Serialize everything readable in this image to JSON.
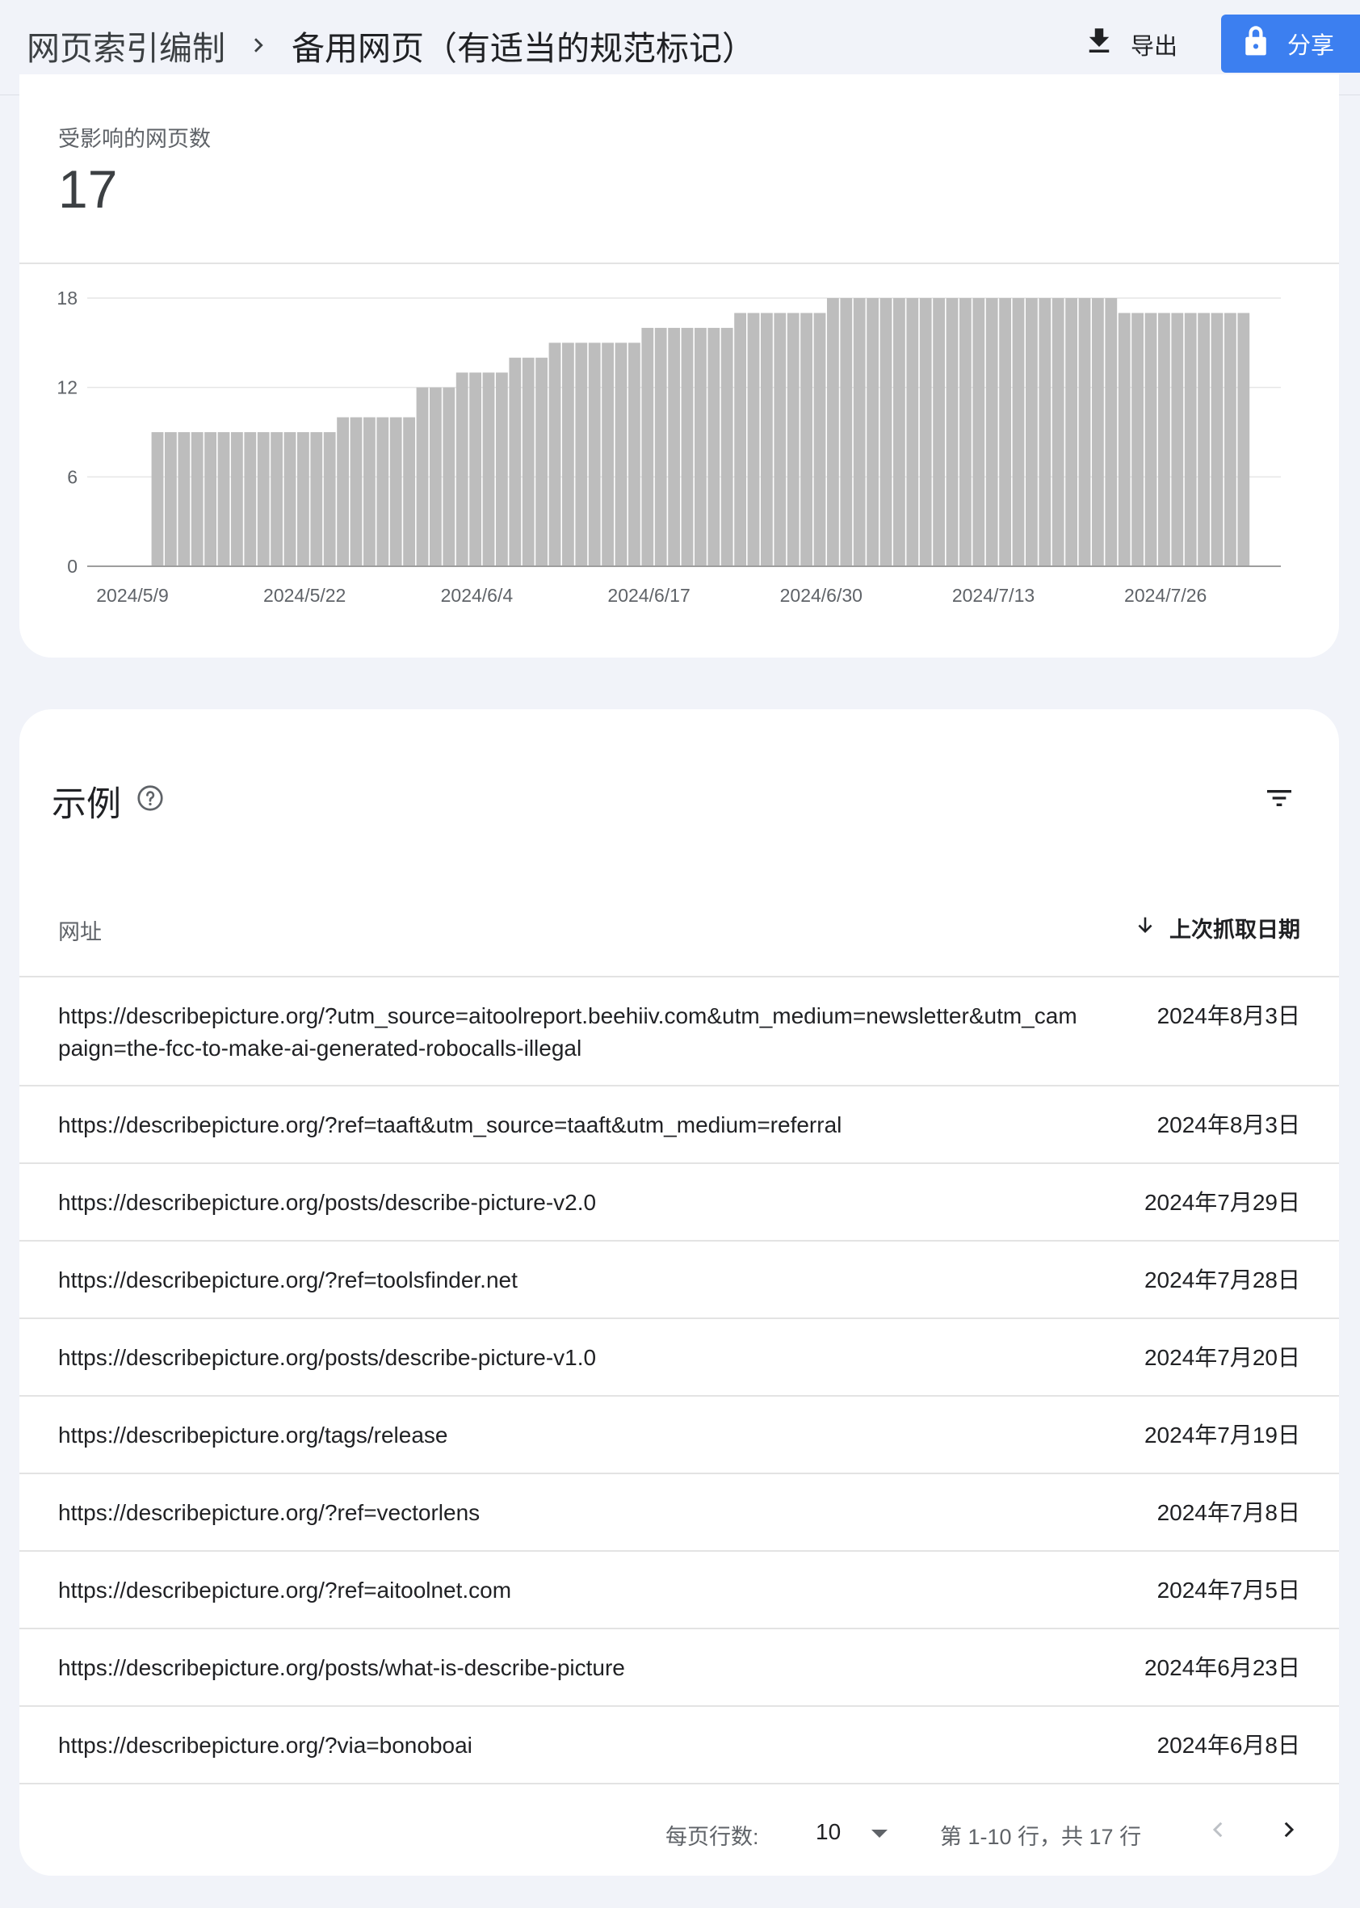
{
  "header": {
    "breadcrumb_parent": "网页索引编制",
    "breadcrumb_current": "备用网页（有适当的规范标记）",
    "export_label": "导出",
    "share_label": "分享"
  },
  "summary": {
    "metric_label": "受影响的网页数",
    "metric_value": "17"
  },
  "chart_data": {
    "type": "bar",
    "title": "",
    "xlabel": "",
    "ylabel": "",
    "ylim": [
      0,
      18
    ],
    "yticks": [
      0,
      6,
      12,
      18
    ],
    "xtick_labels": [
      "2024/5/9",
      "2024/5/22",
      "2024/6/4",
      "2024/6/17",
      "2024/6/30",
      "2024/7/13",
      "2024/7/26"
    ],
    "xtick_indices": [
      0,
      13,
      26,
      39,
      52,
      65,
      78
    ],
    "start_label": "2024/5/9",
    "grid": true,
    "bar_color": "#bdbdbd",
    "values": [
      0,
      0,
      0,
      0,
      9,
      9,
      9,
      9,
      9,
      9,
      9,
      9,
      9,
      9,
      9,
      9,
      9,
      9,
      10,
      10,
      10,
      10,
      10,
      10,
      12,
      12,
      12,
      13,
      13,
      13,
      13,
      14,
      14,
      14,
      15,
      15,
      15,
      15,
      15,
      15,
      15,
      16,
      16,
      16,
      16,
      16,
      16,
      16,
      17,
      17,
      17,
      17,
      17,
      17,
      17,
      18,
      18,
      18,
      18,
      18,
      18,
      18,
      18,
      18,
      18,
      18,
      18,
      18,
      18,
      18,
      18,
      18,
      18,
      18,
      18,
      18,
      18,
      17,
      17,
      17,
      17,
      17,
      17,
      17,
      17,
      17,
      17
    ]
  },
  "examples": {
    "title": "示例",
    "help_icon": "help-circle-icon",
    "filter_icon": "filter-icon",
    "columns": {
      "url": "网址",
      "date": "上次抓取日期"
    },
    "sort_icon": "arrow-down-icon",
    "rows": [
      {
        "url": "https://describepicture.org/?utm_source=aitoolreport.beehiiv.com&utm_medium=newsletter&utm_campaign=the-fcc-to-make-ai-generated-robocalls-illegal",
        "date": "2024年8月3日"
      },
      {
        "url": "https://describepicture.org/?ref=taaft&utm_source=taaft&utm_medium=referral",
        "date": "2024年8月3日"
      },
      {
        "url": "https://describepicture.org/posts/describe-picture-v2.0",
        "date": "2024年7月29日"
      },
      {
        "url": "https://describepicture.org/?ref=toolsfinder.net",
        "date": "2024年7月28日"
      },
      {
        "url": "https://describepicture.org/posts/describe-picture-v1.0",
        "date": "2024年7月20日"
      },
      {
        "url": "https://describepicture.org/tags/release",
        "date": "2024年7月19日"
      },
      {
        "url": "https://describepicture.org/?ref=vectorlens",
        "date": "2024年7月8日"
      },
      {
        "url": "https://describepicture.org/?ref=aitoolnet.com",
        "date": "2024年7月5日"
      },
      {
        "url": "https://describepicture.org/posts/what-is-describe-picture",
        "date": "2024年6月23日"
      },
      {
        "url": "https://describepicture.org/?via=bonoboai",
        "date": "2024年6月8日"
      }
    ]
  },
  "pagination": {
    "rows_per_page_label": "每页行数:",
    "rows_per_page_value": "10",
    "range_text": "第 1-10 行，共 17 行"
  },
  "colors": {
    "accent": "#3c7ff0",
    "page_bg": "#f1f3f9",
    "bar": "#bdbdbd"
  }
}
